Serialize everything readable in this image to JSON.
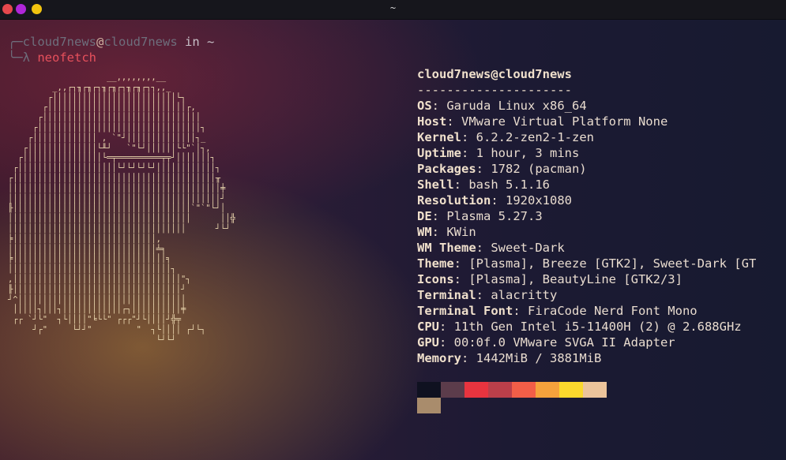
{
  "window": {
    "title": "~",
    "controls": [
      {
        "name": "close",
        "color": "#e5484d"
      },
      {
        "name": "minimize",
        "color": "#b026d9"
      },
      {
        "name": "maximize",
        "color": "#f2c40f"
      }
    ]
  },
  "terminal": {
    "prompt": {
      "prefix_top": "╭─",
      "prefix_bottom": "╰─λ",
      "user": "cloud7news",
      "at": "@",
      "host": "cloud7news",
      "in": "in",
      "path": "~"
    },
    "command": "neofetch",
    "ascii_art": "                    __,,,,,,,,__\n         _,,┌┐╖┌╖┌┐╖┌╖┌┐╖┌╖┌┐┐,,_\n        ┌│││││││││││││││││││││││││└┐\n       ┌││││││││││││││││││││││││││││┌,\n      ┌││││││││││││││││││││││││││││││││\n     ┌│││││││││││││││││││││││││││││││││┐\n    ┌│││││││││││││ , `\"┘││││││││││││││┐_\n   ┌││││││││││││││└╨┘   `\"└┘││││││└└\"`│┐,\n  ┌││││││││││││││││└═╤═════════╤╤┘│││││││┐\n ┌││││││││││││││││││││└┘└┘└┘└┘││││││││││││┐\n┌│││││││││││││││││││││││││││││││││││││││││╥\n│││││││││││││││││││││││││││││││││││││││││││╪\n│││││││││││││││││││││││││││││││││││││││││││┘\n╟││││││││││││││││││││││││││││││││││││`\"`\"└┘│\n│││││││││││││││││││││││││││││││││││││      ││╬\n││││││││││││││││││││││││││││││││││││      ┘└┘\n╞│││││││││││││││││││││││││││││,\n││││││││││││││││││││││││││││││╧╕\n╞│││││││││││││││││││││││││││││││╕\n│││││││││││││││││││││││││││││││││┐\n,││││││││││││││││││││││││││││││││││\"┐\n╟││││││││││││││││││││││││││││││││││┘\n┘^││││││││││││││││││││││││││││││││││\n │││││┐│││┐││││││││││││┌┐││││││││││╪\n ┌┌ `┘└\"  ┐└││││\"╘└└\" ┌┌┌\"┘└││││┘╬╤\n     ┘┌\"     └┘┘\"         \"  ┐└││││ ┌┘└┐\n                              └┘└┘"
  },
  "neofetch": {
    "user_host": "cloud7news@cloud7news",
    "divider": "---------------------",
    "fields": [
      {
        "key": "OS",
        "value": "Garuda Linux x86_64"
      },
      {
        "key": "Host",
        "value": "VMware Virtual Platform None"
      },
      {
        "key": "Kernel",
        "value": "6.2.2-zen2-1-zen"
      },
      {
        "key": "Uptime",
        "value": "1 hour, 3 mins"
      },
      {
        "key": "Packages",
        "value": "1782 (pacman)"
      },
      {
        "key": "Shell",
        "value": "bash 5.1.16"
      },
      {
        "key": "Resolution",
        "value": "1920x1080"
      },
      {
        "key": "DE",
        "value": "Plasma 5.27.3"
      },
      {
        "key": "WM",
        "value": "KWin"
      },
      {
        "key": "WM Theme",
        "value": "Sweet-Dark"
      },
      {
        "key": "Theme",
        "value": "[Plasma], Breeze [GTK2], Sweet-Dark [GT"
      },
      {
        "key": "Icons",
        "value": "[Plasma], BeautyLine [GTK2/3]"
      },
      {
        "key": "Terminal",
        "value": "alacritty"
      },
      {
        "key": "Terminal Font",
        "value": "FiraCode Nerd Font Mono"
      },
      {
        "key": "CPU",
        "value": "11th Gen Intel i5-11400H (2) @ 2.688GHz"
      },
      {
        "key": "GPU",
        "value": "00:0f.0 VMware SVGA II Adapter"
      },
      {
        "key": "Memory",
        "value": "1442MiB / 3881MiB"
      }
    ],
    "palette": [
      "#0f1120",
      "#5c3c4b",
      "#e8343f",
      "#bb3f4a",
      "#f25e48",
      "#f5a23c",
      "#fbd82d",
      "#ecc49b",
      "#a98c6c"
    ]
  }
}
